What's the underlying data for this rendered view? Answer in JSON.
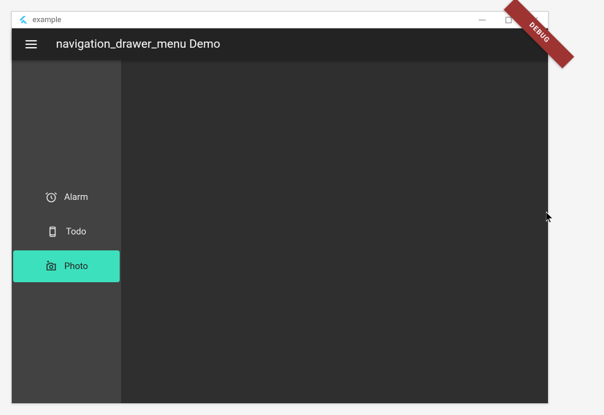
{
  "window": {
    "title": "example"
  },
  "appbar": {
    "title": "navigation_drawer_menu Demo",
    "debug_banner": "DEBUG"
  },
  "drawer": {
    "items": [
      {
        "label": "Alarm",
        "icon": "alarm-clock",
        "selected": false
      },
      {
        "label": "Todo",
        "icon": "smartphone",
        "selected": false
      },
      {
        "label": "Photo",
        "icon": "add-photo",
        "selected": true
      }
    ]
  }
}
